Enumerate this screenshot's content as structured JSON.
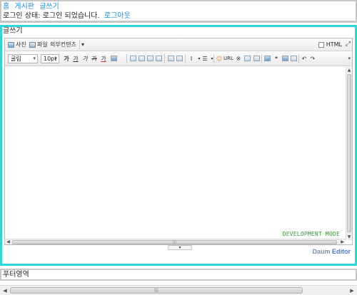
{
  "header": {
    "nav": [
      "홈",
      "게시판",
      "글쓰기"
    ],
    "status_prefix": "로그인 상태: 로그인 되었습니다.",
    "logout": "로그아웃"
  },
  "main": {
    "title": "글쓰기"
  },
  "toolbar_top": {
    "photo": "사진",
    "file": "파일",
    "external": "외부컨텐츠",
    "html_label": "HTML",
    "html_checked": false
  },
  "toolbar_format": {
    "font": "굴림",
    "size": "10pt",
    "bold": "가",
    "underline": "가",
    "italic": "가",
    "strike": "가",
    "color": "가",
    "url": "URL"
  },
  "editor": {
    "dev_mode": "DEVELOPMENT MODE"
  },
  "brand": {
    "part1": "Daum",
    "part2": "Editor"
  },
  "footer": {
    "text": "푸터영역"
  },
  "colors": {
    "accent_border": "#2fd6d6",
    "link": "#1a8fd0",
    "dev_text": "#2f9a2f"
  }
}
